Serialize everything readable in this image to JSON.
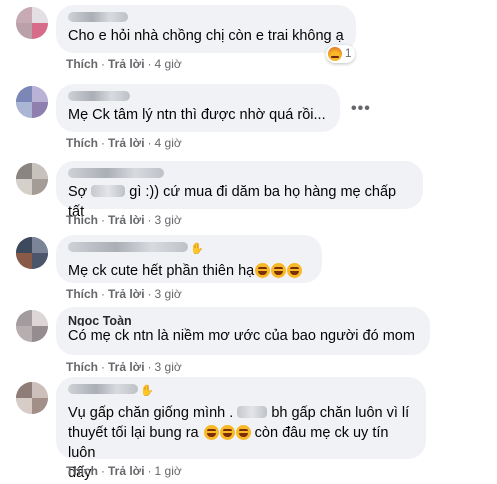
{
  "actions": {
    "like": "Thích",
    "reply": "Trả lời",
    "dot": "·"
  },
  "comments": [
    {
      "text": "Cho e hỏi nhà chồng chị còn e trai không ạ",
      "time": "4 giờ",
      "reaction_count": "1",
      "reaction_icon": "angry-reaction-icon"
    },
    {
      "text": "Mẹ Ck tâm lý ntn thì được nhờ quá rồi...",
      "time": "4 giờ",
      "more": "•••"
    },
    {
      "text_before": "Sợ",
      "text_after": "gì :)) cứ mua đi dăm ba họ hàng mẹ chấp tất",
      "time": "3 giờ"
    },
    {
      "text": "Mẹ ck cute hết phần thiên hạ",
      "emoji": "laughing-emoji",
      "time": "3 giờ"
    },
    {
      "name": "Ngọc Toàn",
      "text": "Có mẹ ck ntn là niềm mơ ước của bao người đó mom",
      "time": "3 giờ"
    },
    {
      "line1_before": "Vụ gấp chăn giống mình .",
      "line1_after": "bh gấp chăn luôn vì lí",
      "line2": "thuyết tối lại bung ra",
      "line2_after": "còn đâu mẹ ck uy tín luôn",
      "line3": "đấy",
      "time": "1 giờ"
    }
  ]
}
